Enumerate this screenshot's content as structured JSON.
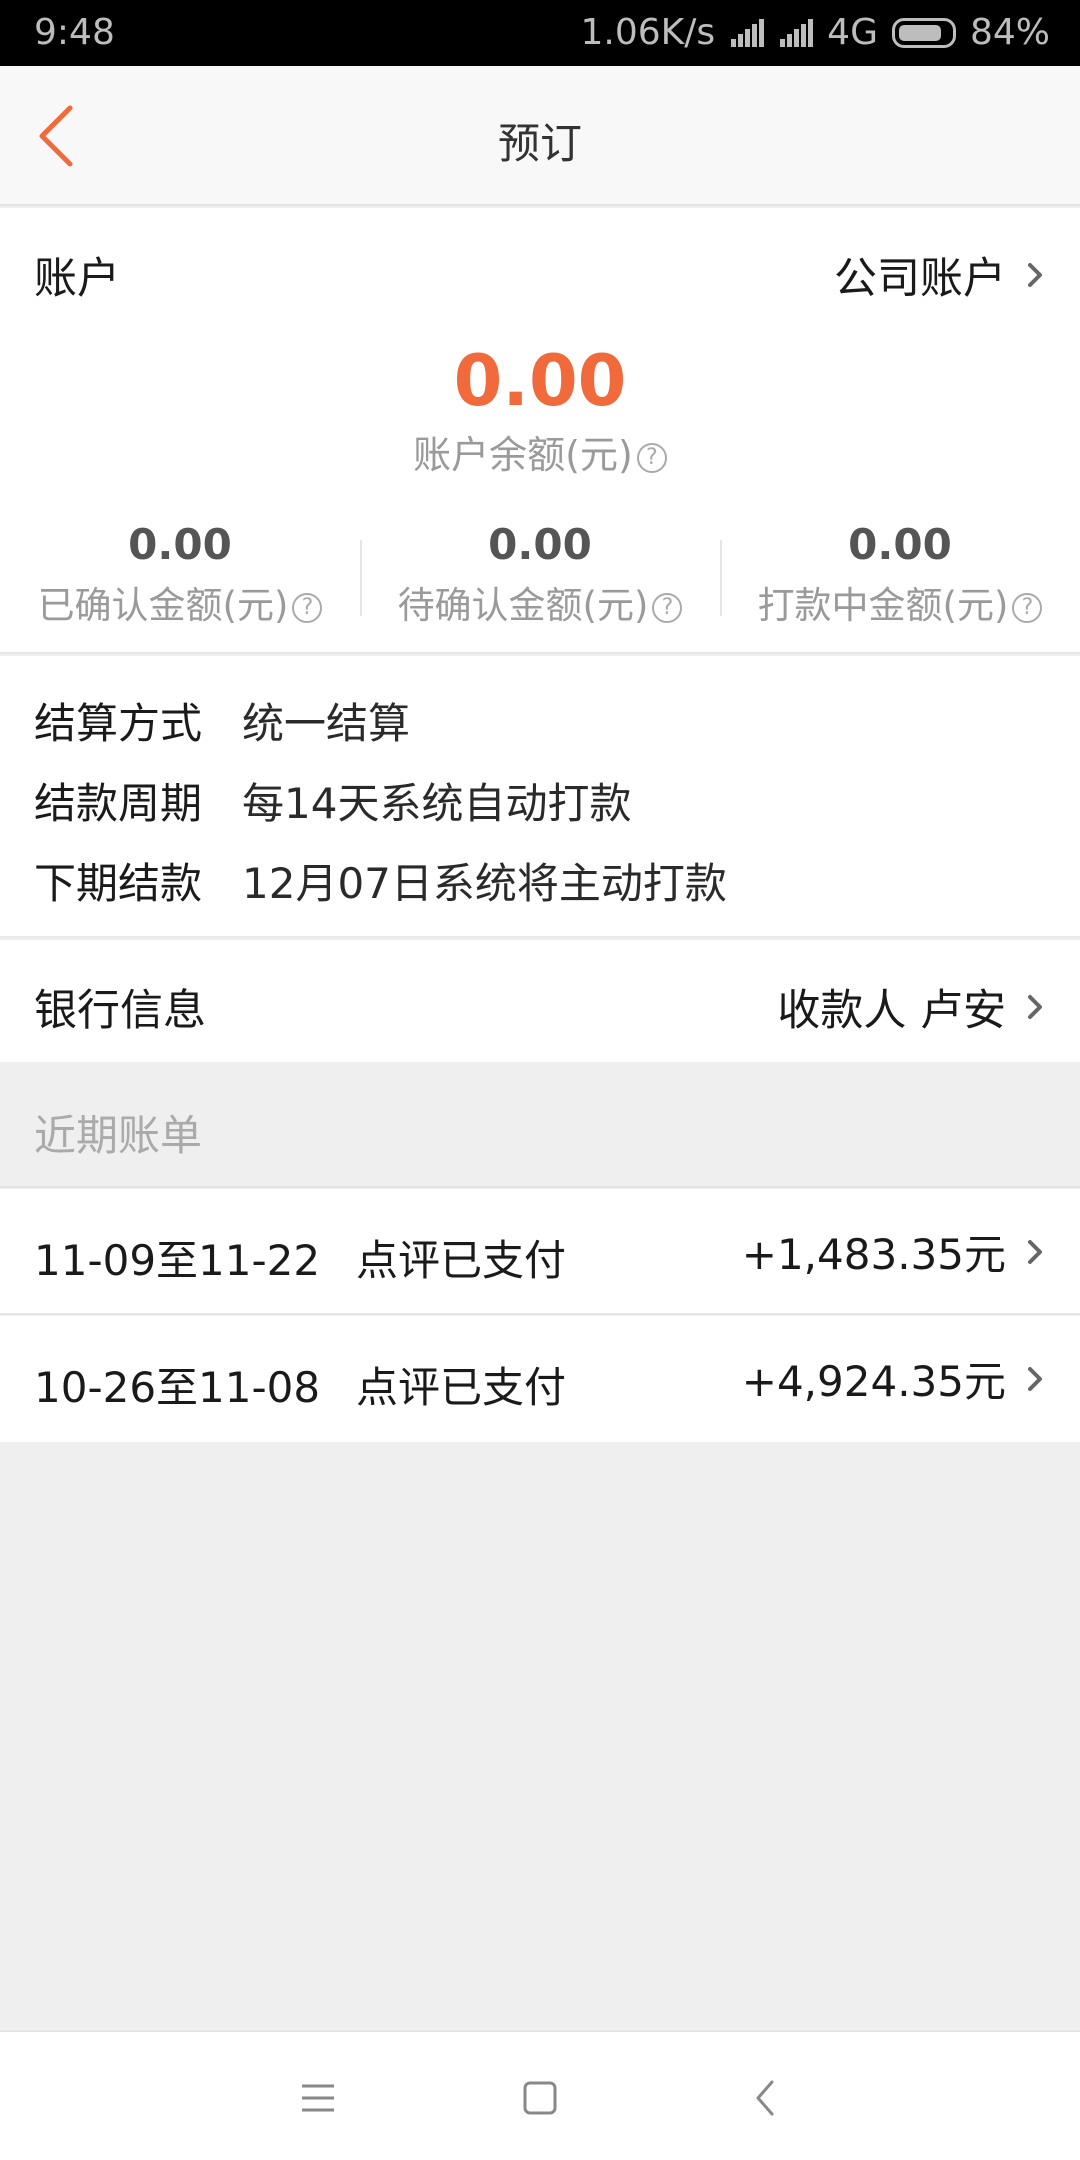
{
  "status_bar": {
    "time": "9:48",
    "speed": "1.06K/s",
    "network": "4G",
    "battery": "84%"
  },
  "header": {
    "title": "预订"
  },
  "account": {
    "label": "账户",
    "type_value": "公司账户",
    "balance": "0.00",
    "balance_label": "账户余额(元)",
    "stats": [
      {
        "value": "0.00",
        "label": "已确认金额(元)"
      },
      {
        "value": "0.00",
        "label": "待确认金额(元)"
      },
      {
        "value": "0.00",
        "label": "打款中金额(元)"
      }
    ]
  },
  "settlement": {
    "method_label": "结算方式",
    "method_value": "统一结算",
    "cycle_label": "结款周期",
    "cycle_value": "每14天系统自动打款",
    "next_label": "下期结款",
    "next_value": "12月07日系统将主动打款"
  },
  "bank": {
    "label": "银行信息",
    "payee": "收款人 卢安"
  },
  "recent": {
    "title": "近期账单",
    "bills": [
      {
        "period": "11-09至11-22",
        "status": "点评已支付",
        "amount": "+1,483.35元"
      },
      {
        "period": "10-26至11-08",
        "status": "点评已支付",
        "amount": "+4,924.35元"
      }
    ]
  },
  "colors": {
    "accent": "#f06a3c",
    "background": "#efefef"
  },
  "icons": {
    "back": "chevron-left-icon",
    "row_arrow": "chevron-right-icon",
    "help": "question-circle-icon",
    "nav_menu": "menu-icon",
    "nav_home": "home-square-icon",
    "nav_back": "back-icon"
  }
}
